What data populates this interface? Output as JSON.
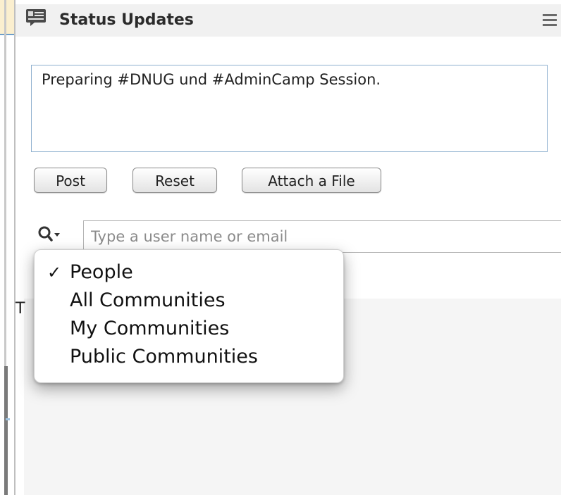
{
  "panel": {
    "title": "Status Updates",
    "header_icon": "status-updates-icon",
    "menu_icon": "menu-icon"
  },
  "status": {
    "value": "Preparing #DNUG und #AdminCamp Session."
  },
  "buttons": {
    "post": "Post",
    "reset": "Reset",
    "attach": "Attach a File"
  },
  "search": {
    "placeholder": "Type a user name or email",
    "icon": "search-icon"
  },
  "dropdown": {
    "items": [
      {
        "label": "People",
        "checked": true
      },
      {
        "label": "All Communities",
        "checked": false
      },
      {
        "label": "My Communities",
        "checked": false
      },
      {
        "label": "Public Communities",
        "checked": false
      }
    ],
    "check_glyph": "✓"
  },
  "list": {
    "initial": "T"
  },
  "colors": {
    "accent_border": "#8eb0cf",
    "header_bg": "#f1f1f1",
    "background_tint": "#fbefcf"
  }
}
